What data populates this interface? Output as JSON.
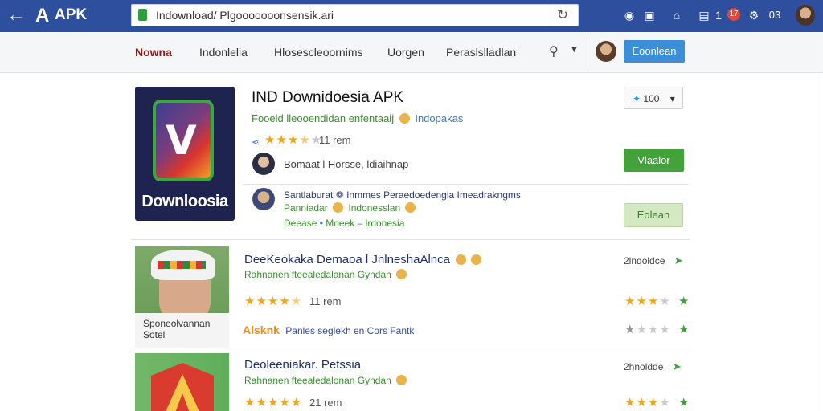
{
  "browser": {
    "brand_text": "APK",
    "url": "Indownload/ Plgooooooonsensik.ari",
    "notification_count": "17",
    "toolbar_extra": "03"
  },
  "nav": {
    "items": [
      "Nowna",
      "Indonlelia",
      "Hlosescleoornims",
      "Uorgen",
      "Peraslslladlan"
    ],
    "primary_button": "Eoonlean"
  },
  "app": {
    "title": "IND Downidoesia APK",
    "subtitle_main": "Fooeld lleooendidan enfentaaij",
    "subtitle_category": "Indopakas",
    "rating": 3.5,
    "rating_count": "11 rem",
    "icon_label": "Downloosia",
    "tweet_label": "100",
    "install_button": "Vlaalor",
    "open_button": "Eolean",
    "developer": "Bomaat l Horsse, ldiaihnap",
    "review": {
      "line1": "Santlaburat ❁ Inmmes Peraedoedengia Imeadrakngms",
      "line2": "Panniadar",
      "line2_b": "Indonesslan",
      "line3_a": "Deease",
      "line3_b": "Moeek",
      "line3_c": "lrdonesia"
    }
  },
  "list": [
    {
      "title": "DeeKeokaka Demaoa l JnlneshaAlnca",
      "subtitle": "Rahnanen fteealedalanan Gyndan",
      "rating": 4.5,
      "rating_count": "11 rem",
      "side_label": "2lndoldce",
      "side_rating": 3,
      "caption_line1": "Sponeolvannan",
      "caption_line2": "Sotel",
      "promo_tag": "Alsknk",
      "promo_text": "Panles seglekh en Cors Fantk",
      "promo_rating": 1
    },
    {
      "title": "Deoleeniakar. Petssia",
      "subtitle": "Rahnanen fteealedalonan Gyndan",
      "rating": 5,
      "rating_count": "21 rem",
      "side_label": "2hnoldde",
      "side_rating": 3
    }
  ],
  "colors": {
    "topbar": "#2d4f9e",
    "primary": "#3d8ed8",
    "install": "#43a33a",
    "star": "#f2a31c",
    "title_blue": "#1f2f72"
  }
}
